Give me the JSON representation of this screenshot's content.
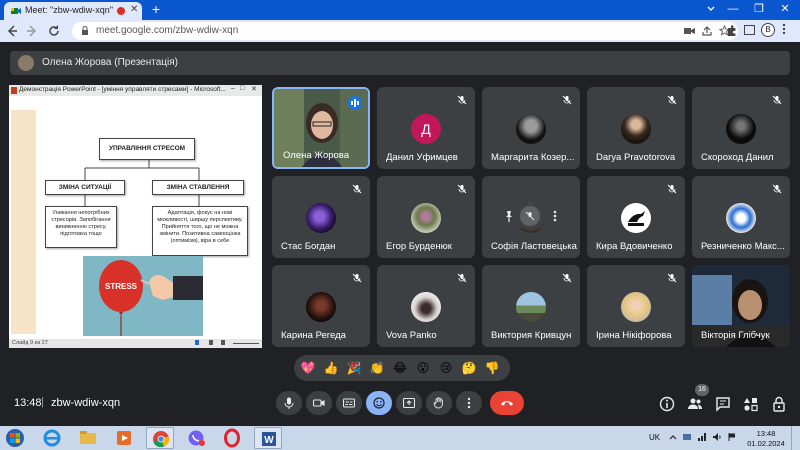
{
  "browser": {
    "tab_title": "Meet: \"zbw-wdiw-xqn\"",
    "tab_close": "✕",
    "new_tab": "+",
    "url": "meet.google.com/zbw-wdiw-xqn",
    "profile_letter": "B",
    "window_min": "—",
    "window_restore": "❐",
    "window_close": "✕"
  },
  "presenter_bar": {
    "label": "Олена Жорова (Презентація)"
  },
  "presentation": {
    "window_title": "Демонстрація PowerPoint - [уміння управляти стресами] - Microsoft...",
    "slide_status": "Слайд 9 из 27",
    "boxes": {
      "main": "УПРАВЛІННЯ СТРЕСОМ",
      "left_head": "ЗМІНА СИТУАЦІЇ",
      "right_head": "ЗМІНА СТАВЛЕННЯ",
      "left_body": "Уникання непотрібних стресорів. Запобігання виникненню стресу, підготовка тощо",
      "right_body": "Адаптація, фокус на нові можливості, ширшу перспективу. Прийняття того, що не можна змінити. Позитивна самооцінка (оптимізм), віра в себе"
    },
    "stress_label": "STRESS"
  },
  "participants": [
    {
      "name": "Олена Жорова",
      "avatar": "photo-woman-glasses",
      "speaking": true
    },
    {
      "name": "Данил Уфимцев",
      "avatar_letter": "Д",
      "avatar_color": "#c2185b"
    },
    {
      "name": "Маргарита Козер...",
      "avatar": "photo-dark-portrait"
    },
    {
      "name": "Darya Pravotorova",
      "avatar": "photo-dark-portrait"
    },
    {
      "name": "Скороход Данил",
      "avatar": "photo-dark-figure"
    },
    {
      "name": "Стас Богдан",
      "avatar": "photo-purple"
    },
    {
      "name": "Егор Бурденюк",
      "avatar": "photo-flowers"
    },
    {
      "name": "Софія Ластовецька",
      "avatar": "photo-girl",
      "hover": true
    },
    {
      "name": "Кира Вдовиченко",
      "avatar": "puma-logo"
    },
    {
      "name": "Резниченко Макс...",
      "avatar": "photo-blue-ball"
    },
    {
      "name": "Карина Регеда",
      "avatar": "photo-dark-red"
    },
    {
      "name": "Vova Panko",
      "avatar": "photo-white"
    },
    {
      "name": "Виктория Кривцун",
      "avatar": "photo-landscape"
    },
    {
      "name": "Ірина Нікіфорова",
      "avatar": "photo-blonde"
    },
    {
      "name": "Вікторія Глібчук",
      "avatar": "video-feed"
    }
  ],
  "reactions": [
    "💖",
    "👍",
    "🎉",
    "👏",
    "😂",
    "😮",
    "😢",
    "🤔",
    "👎"
  ],
  "bottom_bar": {
    "time": "13:48",
    "separator": "|",
    "meeting_code": "zbw-wdiw-xqn",
    "participant_count": "16"
  },
  "taskbar": {
    "language": "UK",
    "time": "13:48",
    "date": "01.02.2024"
  },
  "colors": {
    "meet_bg": "#202124",
    "tile_bg": "#3c4043",
    "chrome_accent": "#0b57d0",
    "end_call_red": "#ea4335",
    "active_blue": "#8ab4f8"
  }
}
